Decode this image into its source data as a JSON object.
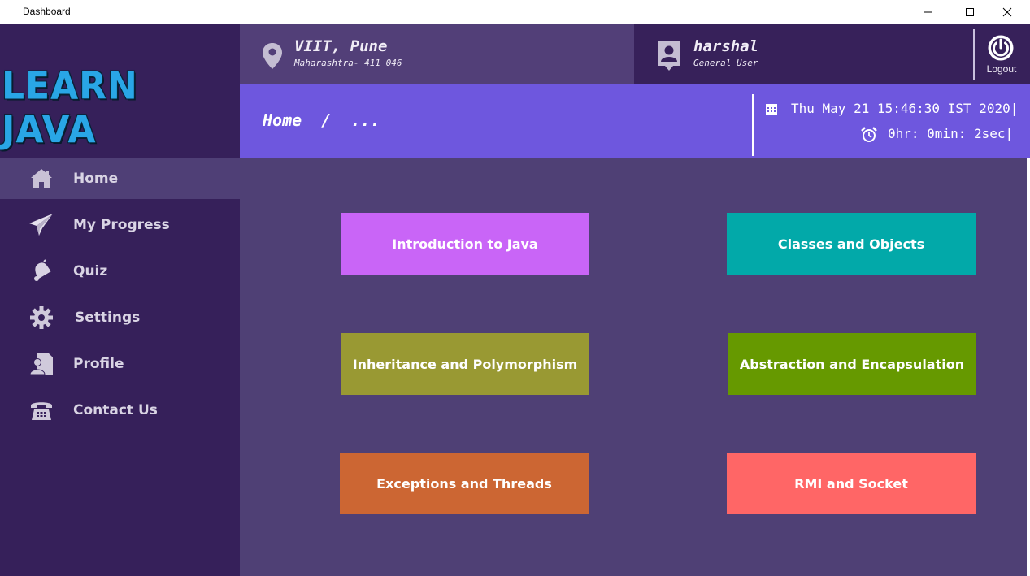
{
  "window": {
    "title": "Dashboard"
  },
  "sidebar": {
    "logo": "LEARN JAVA",
    "items": [
      {
        "label": "Home",
        "icon": "home-icon",
        "active": true
      },
      {
        "label": "My Progress",
        "icon": "paper-plane-icon",
        "active": false
      },
      {
        "label": "Quiz",
        "icon": "bell-icon",
        "active": false
      },
      {
        "label": "Settings",
        "icon": "gear-icon",
        "active": false
      },
      {
        "label": "Profile",
        "icon": "profile-icon",
        "active": false
      },
      {
        "label": "Contact Us",
        "icon": "phone-icon",
        "active": false
      }
    ]
  },
  "header": {
    "location": {
      "title": "VIIT, Pune",
      "subtitle": "Maharashtra- 411 046",
      "icon": "location-pin-icon"
    },
    "user": {
      "name": "harshal",
      "role": "General User",
      "icon": "user-icon"
    },
    "logout": {
      "label": "Logout",
      "icon": "power-icon"
    }
  },
  "breadcrumb": {
    "text": "Home  /  ..."
  },
  "clock": {
    "date": "Thu May 21 15:46:30 IST 2020|",
    "timer": "0hr: 0min: 2sec|",
    "date_icon": "calendar-icon",
    "timer_icon": "alarm-clock-icon"
  },
  "tiles": [
    {
      "label": "Introduction to Java",
      "color": "#c965f7"
    },
    {
      "label": "Classes and Objects",
      "color": "#02a9a9"
    },
    {
      "label": "Inheritance and Polymorphism",
      "color": "#999933"
    },
    {
      "label": "Abstraction and Encapsulation",
      "color": "#669900"
    },
    {
      "label": "Exceptions and Threads",
      "color": "#cc6633"
    },
    {
      "label": "RMI and Socket",
      "color": "#ff6666"
    }
  ],
  "colors": {
    "sidebar": "#36205a",
    "sidebar_active": "#4f3f76",
    "main": "#4f4075",
    "breadcrumb_bar": "#6e57de",
    "header_left": "#523f78",
    "header_right": "#37215a"
  }
}
